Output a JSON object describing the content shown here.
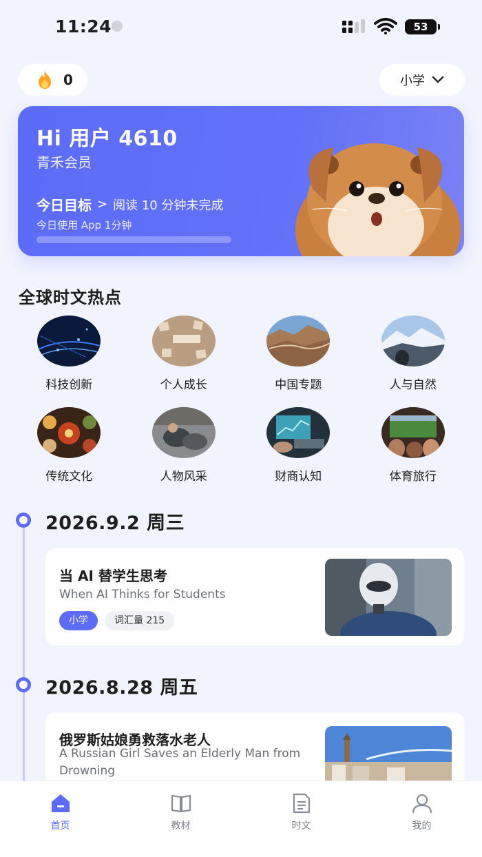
{
  "status": {
    "time": "11:24",
    "battery": "53"
  },
  "header": {
    "streak_count": "0",
    "grade_selector": "小学"
  },
  "hero": {
    "greeting": "Hi 用户 4610",
    "membership": "青禾会员",
    "goal_title": "今日目标",
    "goal_arrow": ">",
    "goal_status": "阅读 10 分钟未完成",
    "usage": "今日使用 App 1分钟",
    "progress_fraction": 0.0
  },
  "topics_section": {
    "title": "全球时文热点",
    "items": [
      {
        "label": "科技创新"
      },
      {
        "label": "个人成长"
      },
      {
        "label": "中国专题"
      },
      {
        "label": "人与自然"
      },
      {
        "label": "传统文化"
      },
      {
        "label": "人物风采"
      },
      {
        "label": "财商认知"
      },
      {
        "label": "体育旅行"
      }
    ]
  },
  "feed": [
    {
      "date": "2026.9.2 周三",
      "title": "当 AI 替学生思考",
      "subtitle": "When AI Thinks for Students",
      "tags": [
        "小学",
        "词汇量 215"
      ]
    },
    {
      "date": "2026.8.28 周五",
      "title": "俄罗斯姑娘勇救落水老人",
      "subtitle": "A Russian Girl Saves an Elderly Man from Drowning",
      "tags": []
    }
  ],
  "tab_bar": {
    "tabs": [
      {
        "label": "首页",
        "icon": "home-icon",
        "active": true
      },
      {
        "label": "教材",
        "icon": "book-icon",
        "active": false
      },
      {
        "label": "时文",
        "icon": "document-icon",
        "active": false
      },
      {
        "label": "我的",
        "icon": "user-icon",
        "active": false
      }
    ]
  },
  "colors": {
    "accent": "#5C6CF8",
    "background": "#F1F4FD",
    "timeline": "#C5CBFA"
  }
}
